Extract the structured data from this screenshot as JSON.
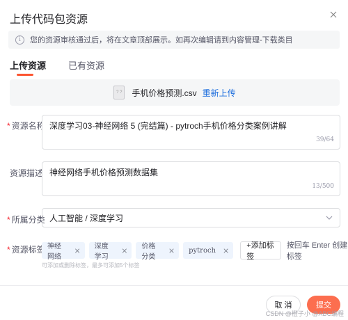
{
  "dialog": {
    "title": "上传代码包资源",
    "close_icon": "close-icon"
  },
  "notice": {
    "icon": "info-icon",
    "text": "您的资源审核通过后，将在文章顶部展示。如再次编辑请到内容管理-下载类目"
  },
  "tabs": [
    {
      "label": "上传资源",
      "active": true
    },
    {
      "label": "已有资源",
      "active": false
    }
  ],
  "file": {
    "icon": "file-icon",
    "icon_text": "? ?",
    "name": "手机价格预测.csv",
    "reupload_label": "重新上传"
  },
  "form": {
    "name": {
      "label": "资源名称",
      "required": "*",
      "value": "深度学习03-神经网络 5 (完结篇) - pytroch手机价格分类案例讲解",
      "counter": "39/64"
    },
    "description": {
      "label": "资源描述",
      "value": "神经网络手机价格预测数据集",
      "counter": "13/500"
    },
    "category": {
      "label": "所属分类",
      "required": "*",
      "value": "人工智能 / 深度学习",
      "icon": "chevron-down-icon"
    },
    "tags": {
      "label": "资源标签",
      "required": "*",
      "items": [
        "神经网络",
        "深度学习",
        "价格分类",
        "pytroch"
      ],
      "remove_symbol": "×",
      "add_label": "+添加标签",
      "hint": "按回车 Enter 创建标签",
      "tip": "可添加或删除标签，最多可添加5个标签"
    }
  },
  "footer": {
    "cancel_label": "取 消",
    "submit_label": "提交",
    "watermark": "CSDN @橙子小 @ABC编程"
  },
  "colors": {
    "accent": "#fc5531",
    "link": "#1b6dde",
    "tag_bg": "#eef4fd"
  }
}
